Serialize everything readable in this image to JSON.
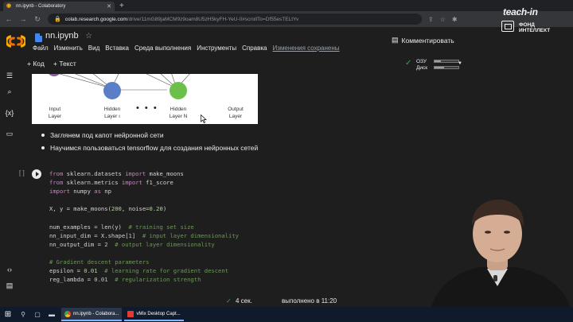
{
  "browser": {
    "tab_title": "nn.ipynb - Colaboratory",
    "url_host": "colab.research.google.com",
    "url_path": "/drive/11mG89jaMCM9z9oam8U5zH5kyFH-YeU-0#scrollTo=Df55esTELtYv"
  },
  "colab": {
    "notebook_title": "nn.ipynb",
    "menu": [
      "Файл",
      "Изменить",
      "Вид",
      "Вставка",
      "Среда выполнения",
      "Инструменты",
      "Справка"
    ],
    "saved_status": "Изменения сохранены",
    "comments_label": "Комментировать",
    "add_code": "+ Код",
    "add_text": "+ Текст",
    "ram_label": "ОЗУ",
    "disk_label": "Диск",
    "ram_level": 0.25,
    "disk_level": 0.4
  },
  "watermark": {
    "brand": "teach-in",
    "line1": "ФОНД",
    "line2": "ИНТЕЛЛЕКТ"
  },
  "diagram": {
    "layers": [
      {
        "label1": "Input",
        "label2": "Layer"
      },
      {
        "label1": "Hidden",
        "label2": "Layer ı"
      },
      {
        "label1": "Hidden",
        "label2": "Layer N"
      },
      {
        "label1": "Output",
        "label2": "Layer"
      }
    ],
    "ellipsis": "• • •"
  },
  "bullets": [
    "Заглянем под капот нейронной сети",
    "Научимся пользоваться tensorflow для создания нейронных сетей"
  ],
  "cell": {
    "bracket": "[ ]",
    "lines": [
      [
        {
          "c": "kw",
          "t": "from"
        },
        {
          "c": "",
          "t": " sklearn.datasets "
        },
        {
          "c": "kw",
          "t": "import"
        },
        {
          "c": "",
          "t": " make_moons"
        }
      ],
      [
        {
          "c": "kw",
          "t": "from"
        },
        {
          "c": "",
          "t": " sklearn.metrics "
        },
        {
          "c": "kw",
          "t": "import"
        },
        {
          "c": "",
          "t": " f1_score"
        }
      ],
      [
        {
          "c": "kw",
          "t": "import"
        },
        {
          "c": "",
          "t": " numpy "
        },
        {
          "c": "kw",
          "t": "as"
        },
        {
          "c": "",
          "t": " np"
        }
      ],
      [],
      [
        {
          "c": "",
          "t": "X, y = make_moons("
        },
        {
          "c": "nm",
          "t": "200"
        },
        {
          "c": "",
          "t": ", noise="
        },
        {
          "c": "nm",
          "t": "0.20"
        },
        {
          "c": "",
          "t": ")"
        }
      ],
      [],
      [
        {
          "c": "",
          "t": "num_examples = len(y)  "
        },
        {
          "c": "cm",
          "t": "# training set size"
        }
      ],
      [
        {
          "c": "",
          "t": "nn_input_dim = X.shape["
        },
        {
          "c": "nm",
          "t": "1"
        },
        {
          "c": "",
          "t": "]  "
        },
        {
          "c": "cm",
          "t": "# input layer dimensionality"
        }
      ],
      [
        {
          "c": "",
          "t": "nn_output_dim = "
        },
        {
          "c": "nm",
          "t": "2"
        },
        {
          "c": "",
          "t": "  "
        },
        {
          "c": "cm",
          "t": "# output layer dimensionality"
        }
      ],
      [],
      [
        {
          "c": "cm",
          "t": "# Gradient descent parameters"
        }
      ],
      [
        {
          "c": "",
          "t": "epsilon = "
        },
        {
          "c": "nm",
          "t": "0.01"
        },
        {
          "c": "",
          "t": "  "
        },
        {
          "c": "cm",
          "t": "# learning rate for gradient descent"
        }
      ],
      [
        {
          "c": "",
          "t": "reg_lambda = "
        },
        {
          "c": "nm",
          "t": "0.01"
        },
        {
          "c": "",
          "t": "  "
        },
        {
          "c": "cm",
          "t": "# regularization strength"
        }
      ]
    ]
  },
  "status": {
    "check": "✓",
    "duration": "4 сек.",
    "completed": "выполнено в 11:20"
  },
  "taskbar": {
    "apps": [
      {
        "label": "nn.ipynb - Colabora...",
        "color": "#f9ab00"
      },
      {
        "label": "vMix Desktop Capt...",
        "color": "#e53935"
      }
    ]
  }
}
